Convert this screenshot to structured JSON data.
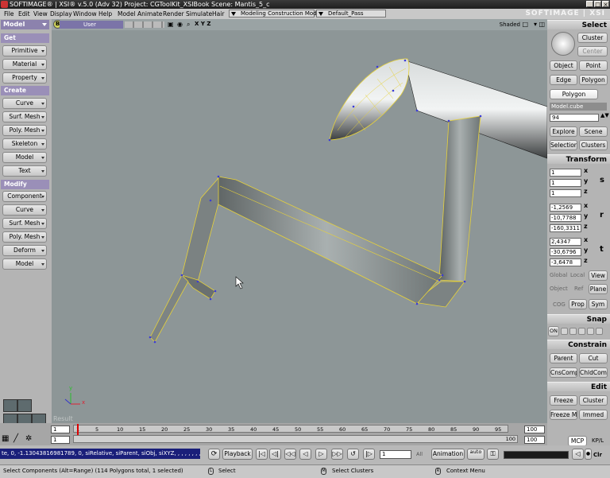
{
  "title_bar": {
    "text": "SOFTIMAGE® | XSI® v.5.0 (Adv 32) Project: CGToolKit_XSIBook   Scene: Mantis_5_c"
  },
  "menu": {
    "items": [
      "File",
      "Edit",
      "View",
      "Display",
      "Window",
      "Help",
      "Model",
      "Animate",
      "Render",
      "Simulate",
      "Hair"
    ],
    "mode": "Modeling Construction Mode",
    "pass": "Default_Pass",
    "logo": "SOFTIMAGE | XSI"
  },
  "left_panel": {
    "module": "Model",
    "get": {
      "header": "Get",
      "items": [
        "Primitive",
        "Material",
        "Property"
      ]
    },
    "create": {
      "header": "Create",
      "items": [
        "Curve",
        "Surf. Mesh",
        "Poly. Mesh",
        "Skeleton",
        "Model",
        "Text"
      ]
    },
    "modify": {
      "header": "Modify",
      "items": [
        "Component",
        "Curve",
        "Surf. Mesh",
        "Poly. Mesh",
        "Deform",
        "Model"
      ]
    }
  },
  "viewport": {
    "badge": "B",
    "camera": "User",
    "axes": "X Y Z",
    "display_mode": "Shaded",
    "result_label": "Result",
    "axis_x": "x",
    "axis_y": "y"
  },
  "right_panel": {
    "select_header": "Select",
    "cluster": "Cluster",
    "center": "Center",
    "object": "Object",
    "point": "Point",
    "edge": "Edge",
    "polygon": "Polygon",
    "polygon_active": "Polygon",
    "selection_name": "Model.cube",
    "selection_count": "94",
    "explore": "Explore",
    "scene": "Scene",
    "selection": "Selection",
    "clusters": "Clusters",
    "transform_header": "Transform",
    "scale": [
      "1",
      "1",
      "1"
    ],
    "rotation": [
      "-1,2569",
      "-10,7788",
      "-160,3311"
    ],
    "translation": [
      "2,4347",
      "-30,6796",
      "-3,6478"
    ],
    "axis_x": "x",
    "axis_y": "y",
    "axis_z": "z",
    "tool_s": "s",
    "tool_r": "r",
    "tool_t": "t",
    "global": "Global",
    "local": "Local",
    "view": "View",
    "object_lbl": "Object",
    "ref": "Ref",
    "plane": "Plane",
    "cog": "COG",
    "prop": "Prop",
    "sym": "Sym",
    "snap_header": "Snap",
    "snap_on": "ON",
    "constrain_header": "Constrain",
    "parent": "Parent",
    "cut": "Cut",
    "cnscomp": "CnsComp",
    "childcomp": "ChldComp",
    "edit_header": "Edit",
    "freeze": "Freeze",
    "cluster2": "Cluster",
    "freeze_m": "Freeze M",
    "immed": "Immed",
    "mcp": "MCP",
    "kpl": "KP/L"
  },
  "timeline": {
    "start": "1",
    "end_field": "1",
    "ticks": [
      "1",
      "5",
      "10",
      "15",
      "20",
      "25",
      "30",
      "35",
      "40",
      "45",
      "50",
      "55",
      "60",
      "65",
      "70",
      "75",
      "80",
      "85",
      "90",
      "95"
    ],
    "end": "100",
    "end2": "100",
    "slider_end": "100"
  },
  "command": {
    "text": "te, 0, -1.13043816981789, 0, siRelative, siParent, siObj, siXYZ, , , , , , , , , 0",
    "playback": "Playback",
    "frame": "1",
    "all": "All",
    "animation": "Animation",
    "auto": "auto",
    "clr": "Clr"
  },
  "status": {
    "message": "Select Components (Alt=Range) (114 Polygons total, 1 selected)",
    "l_label": "L",
    "l_action": "Select",
    "m_label": "M",
    "m_action": "Select Clusters",
    "r_label": "R",
    "r_action": "Context Menu"
  },
  "colors": {
    "module_header": "#8c82ad",
    "wire_highlight": "#e7d23a",
    "viewport_bg": "#8d9697"
  }
}
